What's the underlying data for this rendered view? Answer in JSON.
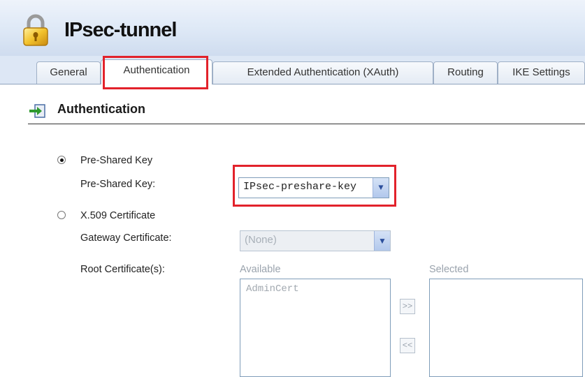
{
  "header": {
    "title": "IPsec-tunnel",
    "icon": "lock-icon"
  },
  "tabs": [
    {
      "label": "General"
    },
    {
      "label": "Authentication",
      "active": true
    },
    {
      "label": "Extended Authentication (XAuth)"
    },
    {
      "label": "Routing"
    },
    {
      "label": "IKE Settings"
    }
  ],
  "section": {
    "title": "Authentication",
    "icon": "arrow-into-box-icon"
  },
  "psk": {
    "radio_label": "Pre-Shared Key",
    "field_label": "Pre-Shared Key:",
    "value": "IPsec-preshare-key",
    "selected": true
  },
  "x509": {
    "radio_label": "X.509 Certificate",
    "gateway_label": "Gateway Certificate:",
    "gateway_value": "(None)",
    "root_label": "Root Certificate(s):",
    "available_label": "Available",
    "selected_label": "Selected",
    "available_items": [
      "AdminCert"
    ],
    "selected_items": [],
    "add_button": ">>",
    "remove_button": "<<"
  },
  "colors": {
    "highlight": "#e2222b",
    "header_bg": "#dde8f6",
    "accent": "#2c4f9c"
  }
}
